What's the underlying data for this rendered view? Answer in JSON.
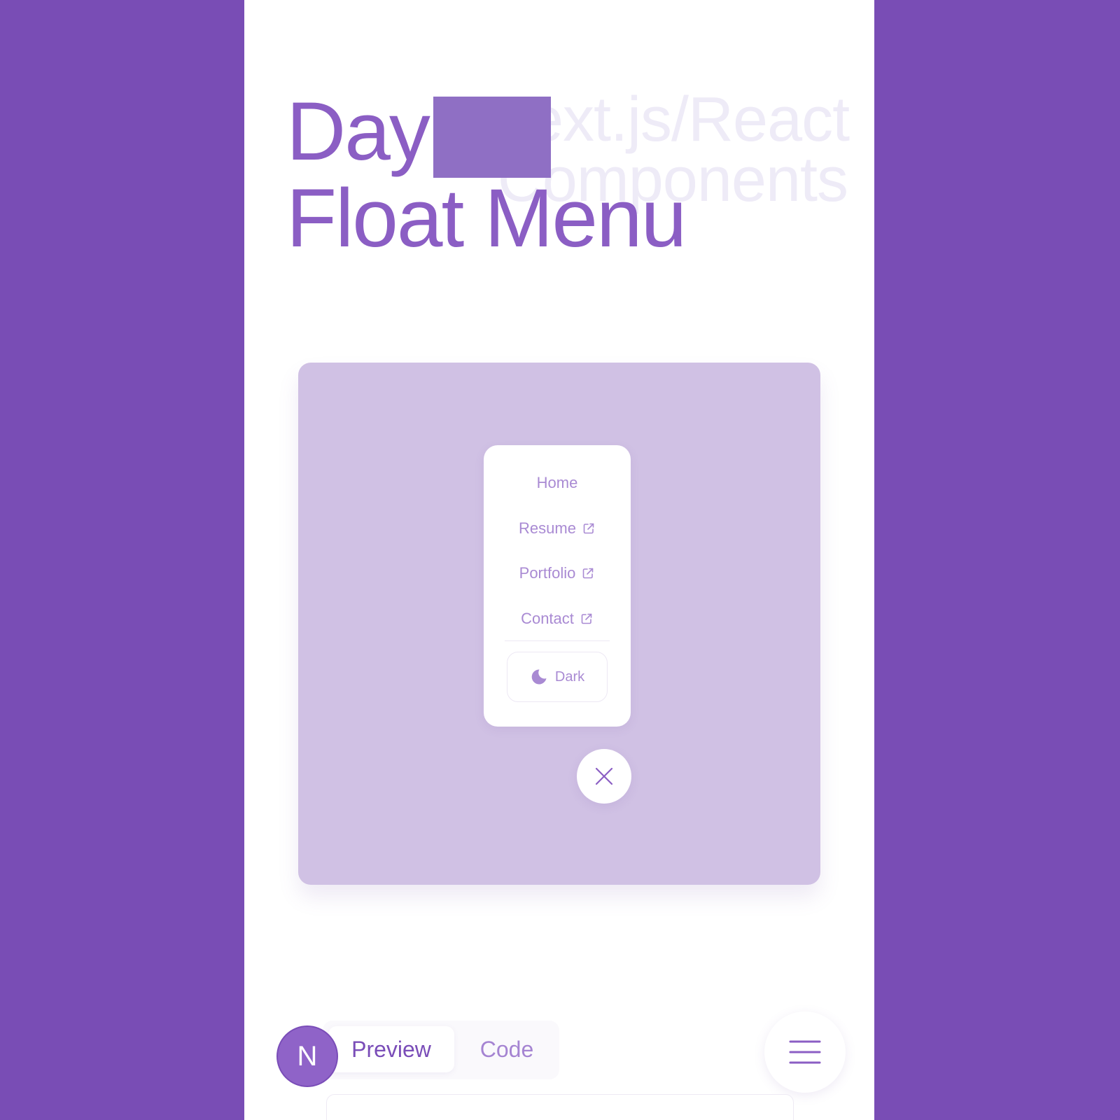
{
  "background_title": {
    "line1": "Next.js/React",
    "line2": "Components"
  },
  "title": {
    "line1_prefix": "Day",
    "line2": "Float Menu"
  },
  "menu": {
    "items": [
      {
        "label": "Home",
        "external": false
      },
      {
        "label": "Resume",
        "external": true
      },
      {
        "label": "Portfolio",
        "external": true
      },
      {
        "label": "Contact",
        "external": true
      }
    ],
    "theme_toggle_label": "Dark"
  },
  "tabs": {
    "preview": "Preview",
    "code": "Code",
    "active": "Preview"
  },
  "avatar_letter": "N",
  "colors": {
    "outer_background": "#794db5",
    "accent": "#8b5ec4",
    "preview_background": "#d0c1e4",
    "menu_text": "#a98ad3"
  },
  "icons": {
    "external_link": "external-link-icon",
    "theme": "moon-icon",
    "close": "close-icon",
    "menu": "hamburger-icon"
  }
}
